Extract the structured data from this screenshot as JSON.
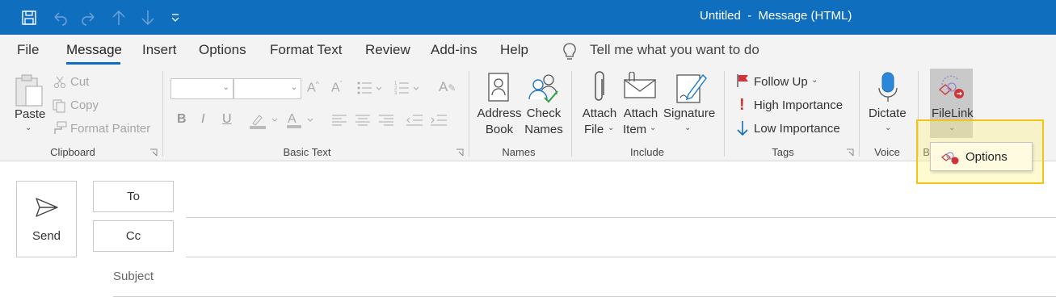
{
  "window": {
    "title": "Untitled  -  Message (HTML)"
  },
  "quick_access": [
    {
      "icon": "save-icon"
    },
    {
      "icon": "undo-icon"
    },
    {
      "icon": "redo-icon"
    },
    {
      "icon": "up-arrow-icon"
    },
    {
      "icon": "down-arrow-icon"
    },
    {
      "icon": "customize-qat-icon"
    }
  ],
  "tabs": [
    "File",
    "Message",
    "Insert",
    "Options",
    "Format Text",
    "Review",
    "Add-ins",
    "Help"
  ],
  "active_tab": "Message",
  "tell_me": "Tell me what you want to do",
  "ribbon": {
    "clipboard": {
      "label": "Clipboard",
      "paste": "Paste",
      "cut": "Cut",
      "copy": "Copy",
      "format_painter": "Format Painter"
    },
    "basic_text": {
      "label": "Basic Text",
      "bold": "B",
      "italic": "I",
      "underline": "U"
    },
    "names": {
      "label": "Names",
      "address_book": [
        "Address",
        "Book"
      ],
      "check_names": [
        "Check",
        "Names"
      ]
    },
    "include": {
      "label": "Include",
      "attach_file": [
        "Attach",
        "File"
      ],
      "attach_item": [
        "Attach",
        "Item"
      ],
      "signature": "Signature"
    },
    "tags": {
      "label": "Tags",
      "follow_up": "Follow Up",
      "high_importance": "High Importance",
      "low_importance": "Low Importance"
    },
    "voice": {
      "label": "Voice",
      "dictate": "Dictate"
    },
    "filelink": {
      "group_label_partial": "Bi",
      "button": "FileLink"
    }
  },
  "dropdown": {
    "options": "Options"
  },
  "compose": {
    "send": "Send",
    "to": "To",
    "cc": "Cc",
    "subject": "Subject"
  },
  "colors": {
    "titlebar": "#106ebe",
    "ribbon_bg": "#f3f3f3",
    "highlight_border": "#f0c419",
    "follow_up_flag": "#d13438",
    "high_importance": "#d13438",
    "low_importance": "#106ebe"
  }
}
